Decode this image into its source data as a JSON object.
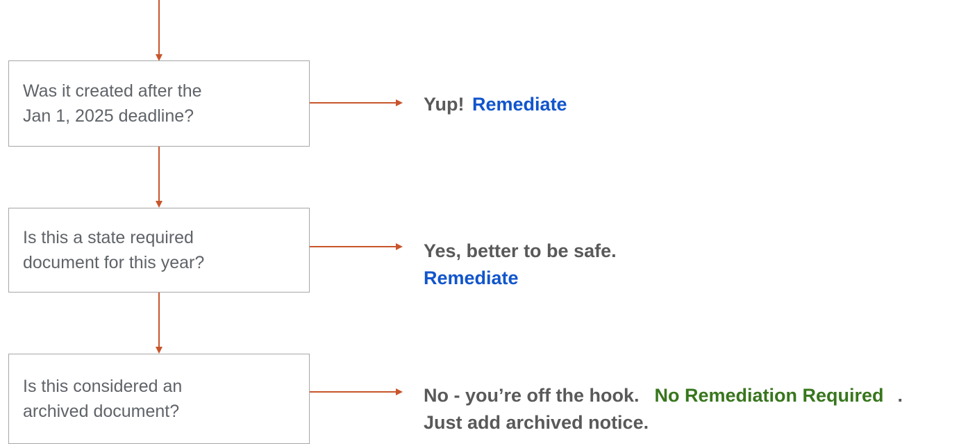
{
  "colors": {
    "arrow": "#c8552b",
    "box_border": "#a6a6a6",
    "question_text": "#5f6368",
    "answer_text": "#595959",
    "remediate": "#1155cc",
    "no_remediation": "#38761d"
  },
  "questions": [
    {
      "text": "Was it created after the\nJan 1, 2025 deadline?"
    },
    {
      "text": "Is this a state required\ndocument for this year?"
    },
    {
      "text": "Is this considered an\narchived document?"
    }
  ],
  "answers": [
    {
      "lead": "Yup!",
      "action": "Remediate"
    },
    {
      "lead": "Yes, better to be safe.",
      "action": "Remediate"
    },
    {
      "lead": "No - you’re off the hook.",
      "action": "No Remediation Required",
      "trail": ".",
      "note": "Just add archived notice."
    }
  ]
}
